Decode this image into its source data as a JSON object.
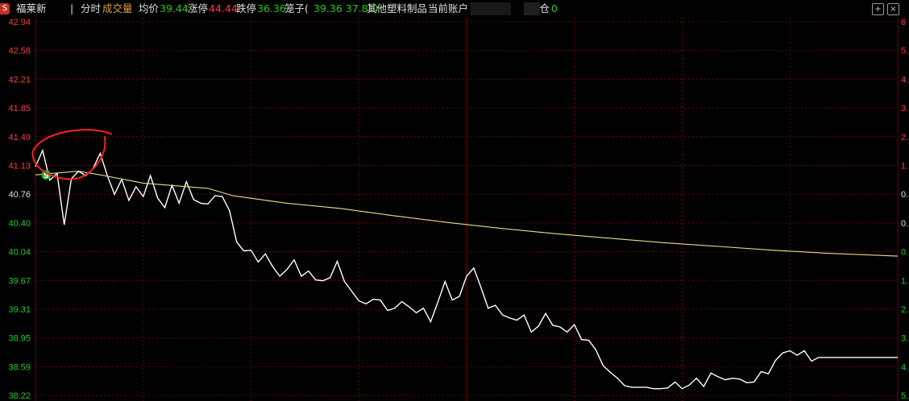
{
  "header": {
    "badge": "S",
    "stock_name": "福莱新",
    "separator": "|",
    "tab_minute": "分时",
    "tab_volume": "成交量",
    "avg_label": "均价",
    "avg_value": "39.44",
    "limit_up_label": "涨停",
    "limit_up_value": "44.44",
    "limit_down_label": "跌停",
    "limit_down_value": "36.36",
    "cage_label": "笼子(",
    "cage_values": "39.36 37.81)",
    "sector": "其他塑料制品",
    "account_label": "当前账户",
    "position_label": "持仓",
    "position_value": "0",
    "btn_zoom": "+",
    "btn_close": "×"
  },
  "colors": {
    "price_line": "#ffffff",
    "avg_line": "#e6e08a",
    "grid": "#7a0000",
    "label_red": "#ff3b3b",
    "label_white": "#e0e0e0",
    "label_green": "#22cc22",
    "annotation": "#ff2020",
    "marker": "#22aa22"
  },
  "chart_data": {
    "type": "line",
    "title": "",
    "xlabel": "",
    "ylabel": "",
    "ylim": [
      37.86,
      42.94
    ],
    "grid": true,
    "y_ticks": [
      "42.94",
      "42.58",
      "42.21",
      "41.85",
      "41.49",
      "41.13",
      "40.76",
      "40.40",
      "40.04",
      "39.67",
      "39.31",
      "38.95",
      "38.59",
      "38.22"
    ],
    "right_ticks": [
      "6",
      "5.",
      "4.",
      "3.",
      "2.",
      "1.",
      "0.",
      "0.",
      "0.",
      "1.",
      "2.",
      "3.",
      "4.",
      "5."
    ],
    "series": [
      {
        "name": "",
        "x": [
          0,
          2,
          4,
          6,
          8,
          10,
          12,
          14,
          16,
          18,
          20,
          22,
          24,
          26,
          28,
          30,
          32,
          34,
          36,
          38,
          40,
          42,
          44,
          46,
          48,
          50,
          52,
          54,
          56,
          58,
          60,
          62,
          64,
          66,
          68,
          70,
          72,
          74,
          76,
          78,
          80,
          82,
          84,
          86,
          88,
          90,
          92,
          94,
          96,
          98,
          100,
          102,
          104,
          106,
          108,
          110,
          112,
          114,
          116,
          118,
          120,
          122,
          124,
          126,
          128,
          130,
          132,
          134,
          136,
          138,
          140,
          142,
          144,
          146,
          148,
          150,
          152,
          154,
          156,
          158,
          160,
          162,
          164,
          166,
          168,
          170,
          172,
          174,
          176,
          178,
          180,
          182,
          184,
          186,
          188,
          190,
          192,
          194,
          196,
          198,
          200,
          202,
          204,
          206,
          208,
          210,
          212,
          214,
          216,
          218,
          220,
          222,
          224,
          226,
          228,
          230,
          232,
          234,
          236,
          238,
          240
        ],
        "values": [
          40.94,
          41.16,
          40.76,
          40.85,
          40.16,
          40.78,
          40.88,
          40.82,
          40.91,
          41.12,
          40.82,
          40.57,
          40.77,
          40.49,
          40.67,
          40.54,
          40.82,
          40.52,
          40.39,
          40.69,
          40.45,
          40.74,
          40.5,
          40.45,
          40.44,
          40.55,
          40.54,
          40.35,
          39.93,
          39.81,
          39.82,
          39.66,
          39.77,
          39.6,
          39.47,
          39.56,
          39.69,
          39.47,
          39.54,
          39.42,
          39.41,
          39.45,
          39.67,
          39.4,
          39.27,
          39.14,
          39.1,
          39.16,
          39.15,
          39.01,
          39.04,
          39.13,
          39.06,
          38.98,
          39.04,
          38.86,
          39.12,
          39.4,
          39.15,
          39.2,
          39.47,
          39.58,
          39.32,
          39.04,
          39.08,
          38.95,
          38.91,
          38.88,
          38.95,
          38.72,
          38.8,
          38.97,
          38.81,
          38.79,
          38.72,
          38.82,
          38.62,
          38.61,
          38.48,
          38.27,
          38.18,
          38.1,
          38.0,
          37.98,
          37.98,
          37.98,
          37.96,
          37.96,
          37.97,
          38.05,
          37.96,
          38.01,
          38.1,
          37.99,
          38.17,
          38.12,
          38.08,
          38.1,
          38.09,
          38.04,
          38.05,
          38.19,
          38.16,
          38.34,
          38.44,
          38.47,
          38.41,
          38.47,
          38.33,
          38.38,
          38.38,
          38.38,
          38.38,
          38.38,
          38.38,
          38.38,
          38.38,
          38.38,
          38.38,
          38.38,
          38.38
        ]
      },
      {
        "name": "",
        "x": [
          0,
          12,
          18,
          30,
          40,
          48,
          55,
          70,
          85,
          100,
          115,
          130,
          145,
          160,
          175,
          190,
          205,
          220,
          240
        ],
        "values": [
          40.83,
          40.88,
          40.83,
          40.72,
          40.68,
          40.65,
          40.55,
          40.45,
          40.38,
          40.28,
          40.19,
          40.11,
          40.04,
          39.98,
          39.92,
          39.87,
          39.82,
          39.78,
          39.74
        ]
      }
    ],
    "annotations": [
      {
        "type": "marker",
        "label": "S",
        "x": 3,
        "value": 40.83
      },
      {
        "type": "hand-drawn-circle",
        "x": 8,
        "value": 41.08
      }
    ]
  }
}
